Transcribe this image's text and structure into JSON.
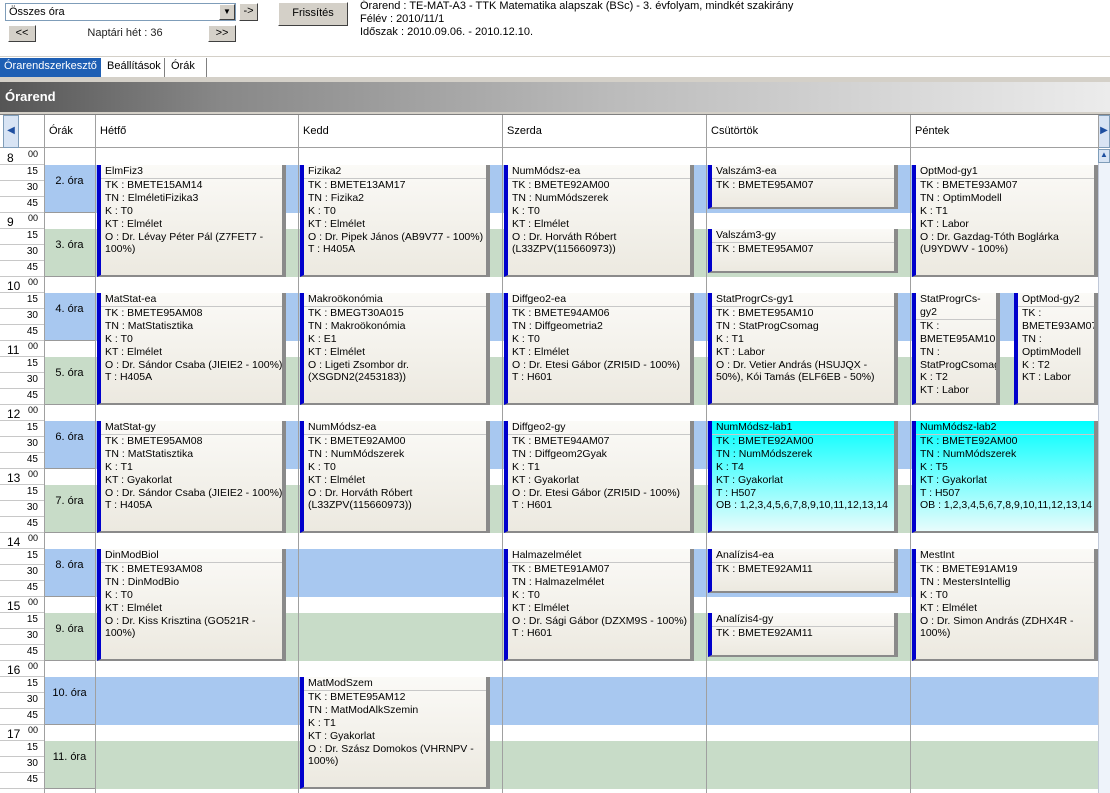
{
  "toolbar": {
    "filter_value": "Összes óra",
    "go_label": "->",
    "refresh_label": "Frissítés",
    "prev_label": "<<",
    "next_label": ">>",
    "week_label": "Naptári hét : 36"
  },
  "info": {
    "line1": "Órarend : TE-MAT-A3 - TTK Matematika alapszak (BSc) - 3. évfolyam, mindkét szakirány",
    "line2": "Félév : 2010/11/1",
    "line3": "Időszak : 2010.09.06. - 2010.12.10."
  },
  "tabs": [
    "Órarendszerkesztő",
    "Beállítások",
    "Órák"
  ],
  "panel_title": "Órarend",
  "columns": [
    "Órák",
    "Hétfő",
    "Kedd",
    "Szerda",
    "Csütörtök",
    "Péntek"
  ],
  "hours": [
    "8",
    "9",
    "10",
    "11",
    "12",
    "13",
    "14",
    "15",
    "16",
    "17"
  ],
  "minutes": [
    "00",
    "15",
    "30",
    "45"
  ],
  "ora_labels": [
    "2. óra",
    "3. óra",
    "4. óra",
    "5. óra",
    "6. óra",
    "7. óra",
    "8. óra",
    "9. óra",
    "10. óra",
    "11. óra"
  ],
  "colors": {
    "blue_band": "#a8c8f0",
    "green_band": "#c8dcc8",
    "cyan": "#00ffff",
    "accent": "#0000cc",
    "tab_active": "#1e5fb4"
  },
  "events": [
    {
      "title": "ElmFiz3",
      "lines": [
        "TK : BMETE15AM14",
        "TN : ElméletiFizika3",
        "K : T0",
        "KT : Elmélet",
        "O :  Dr. Lévay Péter Pál (Z7FET7 - 100%)"
      ]
    },
    {
      "title": "Fizika2",
      "lines": [
        "TK : BMETE13AM17",
        "TN : Fizika2",
        "K : T0",
        "KT : Elmélet",
        "O :  Dr. Pipek János (AB9V77 - 100%)",
        "T : H405A"
      ]
    },
    {
      "title": "NumMódsz-ea",
      "lines": [
        "TK : BMETE92AM00",
        "TN : NumMódszerek",
        "K : T0",
        "KT : Elmélet",
        "O :  Dr. Horváth Róbert (L33ZPV(115660973))"
      ]
    },
    {
      "title": "Valszám3-ea",
      "lines": [
        "TK : BMETE95AM07"
      ]
    },
    {
      "title": "Valszám3-gy",
      "lines": [
        "TK : BMETE95AM07"
      ]
    },
    {
      "title": "OptMod-gy1",
      "lines": [
        "TK : BMETE93AM07",
        "TN : OptimModell",
        "K : T1",
        "KT : Labor",
        "O :  Dr. Gazdag-Tóth Boglárka (U9YDWV - 100%)"
      ]
    },
    {
      "title": "MatStat-ea",
      "lines": [
        "TK : BMETE95AM08",
        "TN : MatStatisztika",
        "K : T0",
        "KT : Elmélet",
        "O :  Dr. Sándor Csaba (JIEIE2 - 100%)",
        "T : H405A"
      ]
    },
    {
      "title": "Makroökonómia",
      "lines": [
        "TK : BMEGT30A015",
        "TN : Makroökonómia",
        "K : E1",
        "KT : Elmélet",
        "O :  Ligeti Zsombor dr. (XSGDN2(2453183))"
      ]
    },
    {
      "title": "Diffgeo2-ea",
      "lines": [
        "TK : BMETE94AM06",
        "TN : Diffgeometria2",
        "K : T0",
        "KT : Elmélet",
        "O :  Dr. Etesi Gábor (ZRI5ID - 100%)",
        "T : H601"
      ]
    },
    {
      "title": "StatProgrCs-gy1",
      "lines": [
        "TK : BMETE95AM10",
        "TN : StatProgCsomag",
        "K : T1",
        "KT : Labor",
        "O :  Dr. Vetier András (HSUJQX - 50%), Kói Tamás (ELF6EB - 50%)"
      ]
    },
    {
      "title": "StatProgrCs-gy2",
      "lines": [
        "TK : BMETE95AM10",
        "TN : StatProgCsomag",
        "K : T2",
        "KT : Labor"
      ]
    },
    {
      "title": "OptMod-gy2",
      "lines": [
        "TK : BMETE93AM07",
        "TN : OptimModell",
        "K : T2",
        "KT : Labor"
      ]
    },
    {
      "title": "MatStat-gy",
      "lines": [
        "TK : BMETE95AM08",
        "TN : MatStatisztika",
        "K : T1",
        "KT : Gyakorlat",
        "O :  Dr. Sándor Csaba (JIEIE2 - 100%)",
        "T : H405A"
      ]
    },
    {
      "title": "NumMódsz-ea",
      "lines": [
        "TK : BMETE92AM00",
        "TN : NumMódszerek",
        "K : T0",
        "KT : Elmélet",
        "O :  Dr. Horváth Róbert (L33ZPV(115660973))"
      ]
    },
    {
      "title": "Diffgeo2-gy",
      "lines": [
        "TK : BMETE94AM07",
        "TN : Diffgeom2Gyak",
        "K : T1",
        "KT : Gyakorlat",
        "O :  Dr. Etesi Gábor (ZRI5ID - 100%)",
        "T : H601"
      ]
    },
    {
      "title": "NumMódsz-lab1",
      "lines": [
        "TK : BMETE92AM00",
        "TN : NumMódszerek",
        "K : T4",
        "KT : Gyakorlat",
        "T : H507",
        "OB : 1,2,3,4,5,6,7,8,9,10,11,12,13,14"
      ]
    },
    {
      "title": "NumMódsz-lab2",
      "lines": [
        "TK : BMETE92AM00",
        "TN : NumMódszerek",
        "K : T5",
        "KT : Gyakorlat",
        "T : H507",
        "OB : 1,2,3,4,5,6,7,8,9,10,11,12,13,14"
      ]
    },
    {
      "title": "DinModBiol",
      "lines": [
        "TK : BMETE93AM08",
        "TN : DinModBio",
        "K : T0",
        "KT : Elmélet",
        "O :  Dr. Kiss Krisztina (GO521R - 100%)"
      ]
    },
    {
      "title": "Halmazelmélet",
      "lines": [
        "TK : BMETE91AM07",
        "TN : Halmazelmélet",
        "K : T0",
        "KT : Elmélet",
        "O :  Dr. Sági Gábor (DZXM9S - 100%)",
        "T : H601"
      ]
    },
    {
      "title": "Analízis4-ea",
      "lines": [
        "TK : BMETE92AM11"
      ]
    },
    {
      "title": "Analízis4-gy",
      "lines": [
        "TK : BMETE92AM11"
      ]
    },
    {
      "title": "MestInt",
      "lines": [
        "TK : BMETE91AM19",
        "TN : MestersIntellig",
        "K : T0",
        "KT : Elmélet",
        "O :  Dr. Simon András (ZDHX4R - 100%)"
      ]
    },
    {
      "title": "MatModSzem",
      "lines": [
        "TK : BMETE95AM12",
        "TN : MatModAlkSzemin",
        "K : T1",
        "KT : Gyakorlat",
        "O :  Dr. Szász Domokos (VHRNPV - 100%)"
      ]
    }
  ]
}
